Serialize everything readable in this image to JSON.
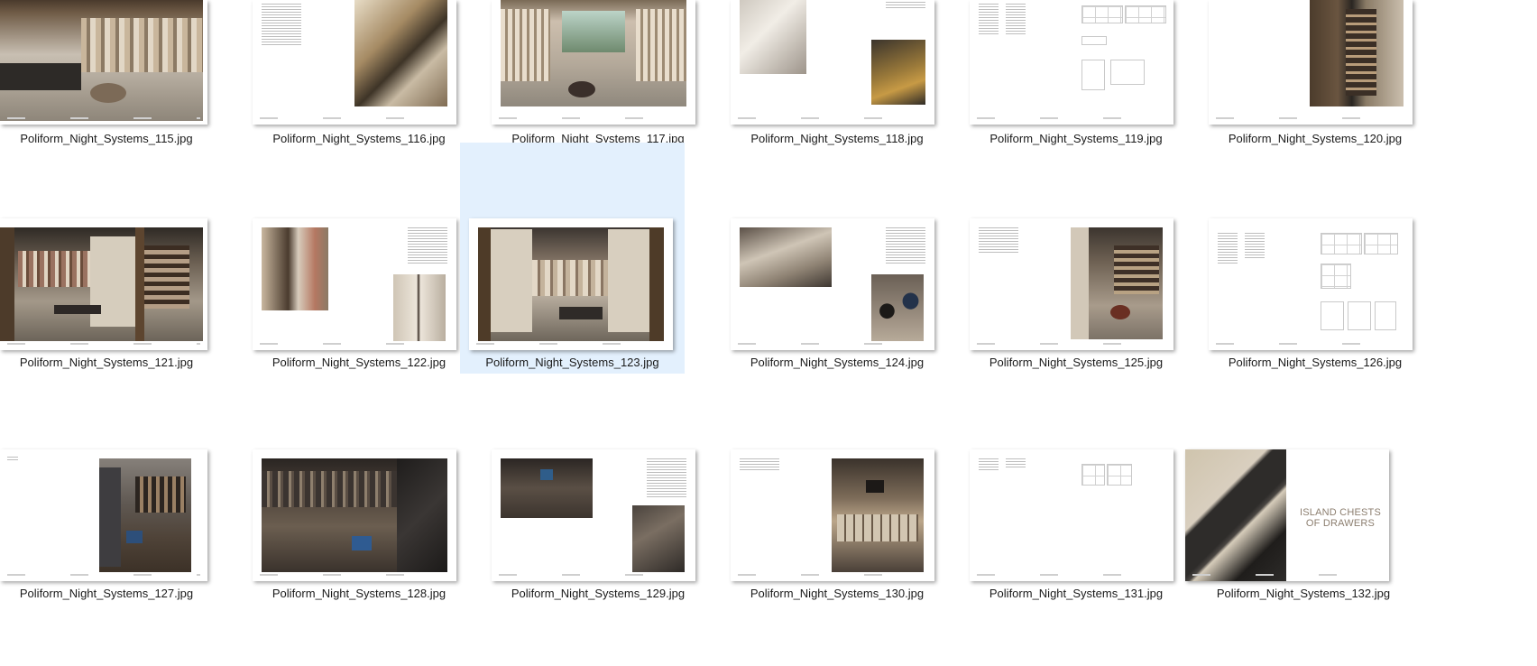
{
  "files": [
    "Poliform_Night_Systems_115.jpg",
    "Poliform_Night_Systems_116.jpg",
    "Poliform_Night_Systems_117.jpg",
    "Poliform_Night_Systems_118.jpg",
    "Poliform_Night_Systems_119.jpg",
    "Poliform_Night_Systems_120.jpg",
    "Poliform_Night_Systems_121.jpg",
    "Poliform_Night_Systems_122.jpg",
    "Poliform_Night_Systems_123.jpg",
    "Poliform_Night_Systems_124.jpg",
    "Poliform_Night_Systems_125.jpg",
    "Poliform_Night_Systems_126.jpg",
    "Poliform_Night_Systems_127.jpg",
    "Poliform_Night_Systems_128.jpg",
    "Poliform_Night_Systems_129.jpg",
    "Poliform_Night_Systems_130.jpg",
    "Poliform_Night_Systems_131.jpg",
    "Poliform_Night_Systems_132.jpg"
  ],
  "selected_file": "Poliform_Night_Systems_123.jpg",
  "page_132_heading": "ISLAND CHESTS\nOF DRAWERS",
  "colors": {
    "selection": "#e3f0fd",
    "walnut": "#5c4632",
    "cream": "#d9cfbf",
    "dark": "#2e2c2a"
  }
}
